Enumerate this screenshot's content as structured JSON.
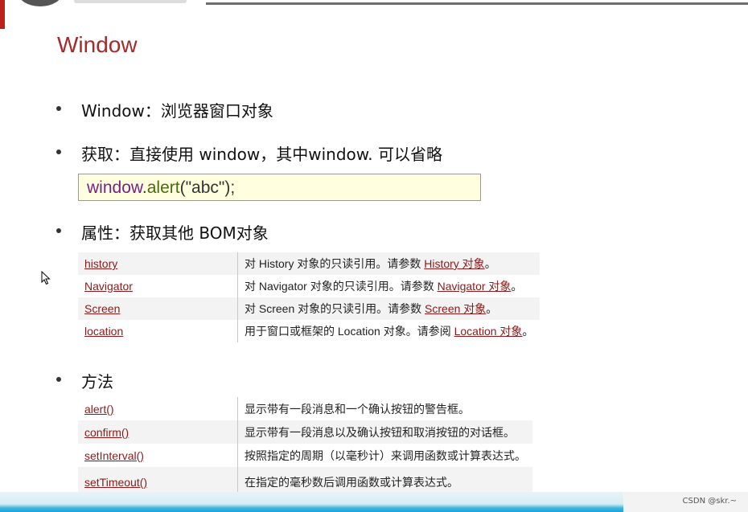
{
  "title": "Window",
  "bullets": [
    "Window：浏览器窗口对象",
    "获取：直接使用 window，其中window. 可以省略",
    "属性：获取其他 BOM对象",
    "方法"
  ],
  "code": {
    "obj": "window",
    "dot": ".",
    "fn": "alert",
    "open": "(",
    "str": "\"abc\"",
    "close": ");"
  },
  "properties": [
    {
      "name": "history",
      "desc": "对 History 对象的只读引用。请参数 ",
      "link": "History 对象",
      "end": "。"
    },
    {
      "name": "Navigator",
      "desc": "对 Navigator 对象的只读引用。请参数 ",
      "link": "Navigator 对象",
      "end": "。"
    },
    {
      "name": "Screen",
      "desc": "对 Screen 对象的只读引用。请参数 ",
      "link": "Screen 对象",
      "end": "。"
    },
    {
      "name": "location",
      "desc": "用于窗口或框架的 Location 对象。请参阅 ",
      "link": "Location 对象",
      "end": "。"
    }
  ],
  "methods": [
    {
      "name": "alert()",
      "desc": "显示带有一段消息和一个确认按钮的警告框。"
    },
    {
      "name": "confirm()",
      "desc": "显示带有一段消息以及确认按钮和取消按钮的对话框。"
    },
    {
      "name": "setInterval()",
      "desc": "按照指定的周期（以毫秒计）来调用函数或计算表达式。"
    },
    {
      "name": "setTimeout()",
      "desc": "在指定的毫秒数后调用函数或计算表达式。"
    }
  ],
  "watermark": "CSDN @skr.~"
}
